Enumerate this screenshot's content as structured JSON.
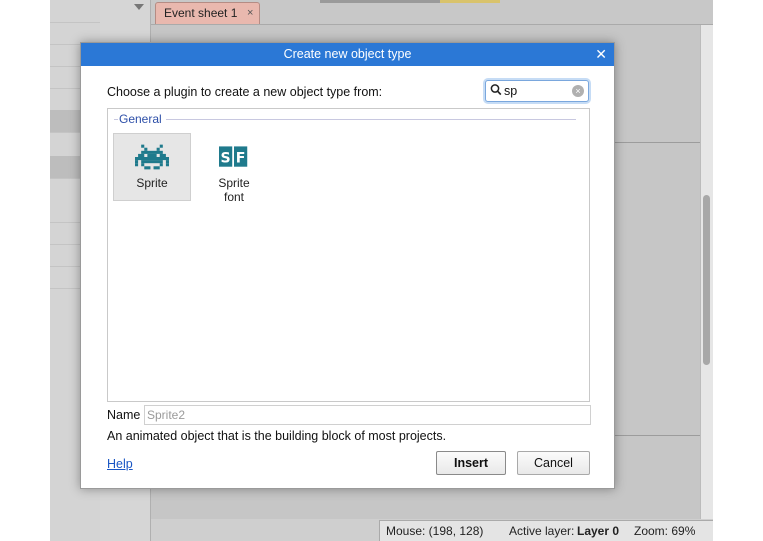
{
  "editor": {
    "tab_label": "Event sheet 1",
    "tab_close": "×"
  },
  "status_bar": {
    "mouse": "Mouse: (198, 128)",
    "active_layer_label": "Active layer:",
    "active_layer_value": "Layer 0",
    "zoom": "Zoom: 69%"
  },
  "dialog": {
    "title": "Create new object type",
    "close_glyph": "✕",
    "prompt": "Choose a plugin to create a new object type from:",
    "search": {
      "value": "sp",
      "placeholder": ""
    },
    "group_label": "General",
    "plugins": [
      {
        "label": "Sprite",
        "icon": "space-invader-icon",
        "selected": true
      },
      {
        "label": "Sprite\nfont",
        "label_line1": "Sprite",
        "label_line2": "font",
        "icon": "sprite-font-icon",
        "selected": false
      }
    ],
    "name_label": "Name",
    "name_placeholder": "Sprite2",
    "description": "An animated object that is the building block of most projects.",
    "help_link": "Help",
    "insert_button": "Insert",
    "cancel_button": "Cancel"
  },
  "colors": {
    "title_bar": "#2b78d6",
    "plugin_icon": "#1f7a8c",
    "group_label": "#2d4fa8",
    "tab": "#e9b8ae"
  }
}
